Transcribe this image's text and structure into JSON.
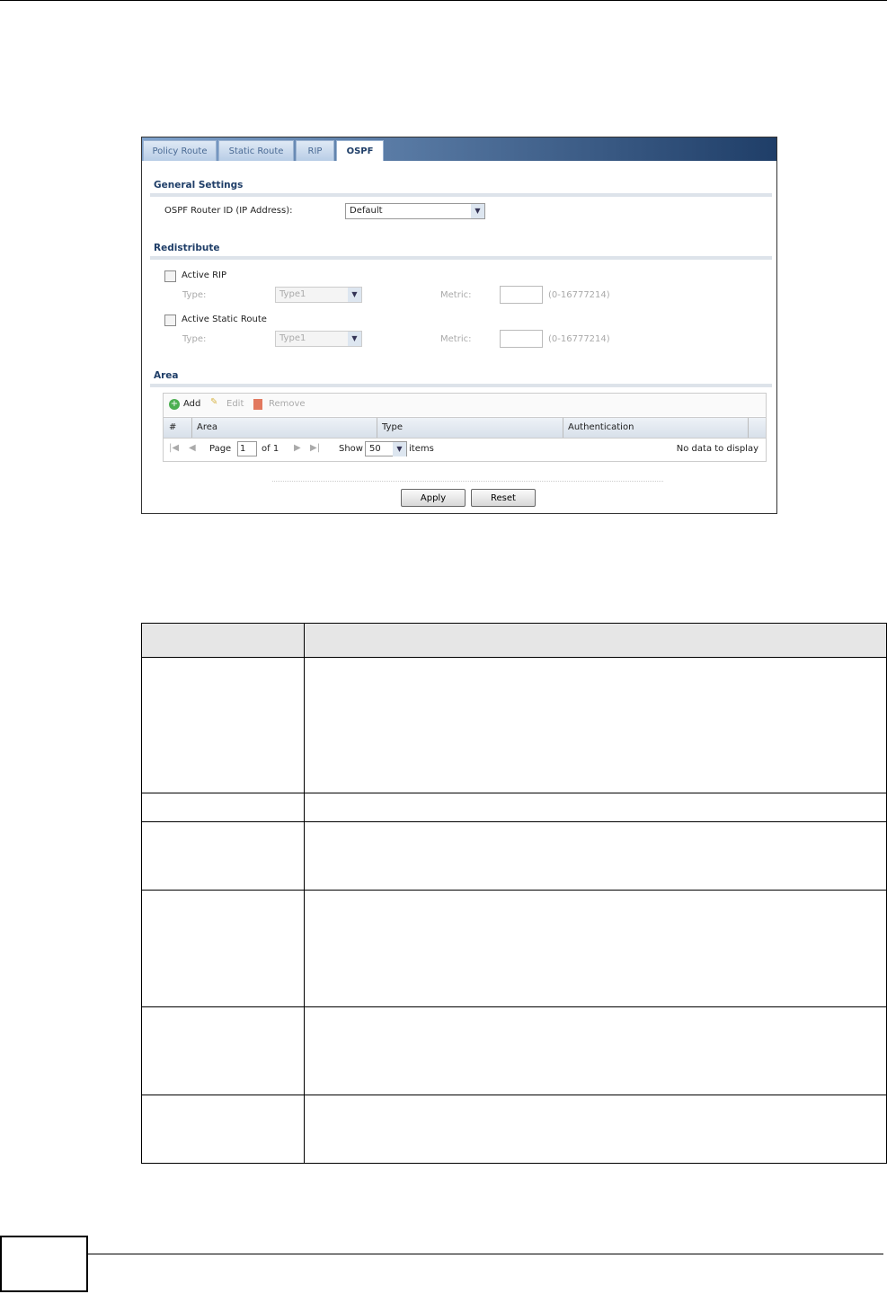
{
  "tabs": [
    "Policy Route",
    "Static Route",
    "RIP",
    "OSPF"
  ],
  "general": {
    "title": "General Settings",
    "router_id_label": "OSPF Router ID (IP Address):",
    "router_id_value": "Default"
  },
  "redistribute": {
    "title": "Redistribute",
    "rows": [
      {
        "label": "Active RIP",
        "type_label": "Type:",
        "type_value": "Type1",
        "metric_label": "Metric:",
        "range": "(0-16777214)"
      },
      {
        "label": "Active Static Route",
        "type_label": "Type:",
        "type_value": "Type1",
        "metric_label": "Metric:",
        "range": "(0-16777214)"
      }
    ]
  },
  "area": {
    "title": "Area",
    "toolbar": {
      "add": "Add",
      "edit": "Edit",
      "remove": "Remove"
    },
    "columns": [
      "#",
      "Area",
      "Type",
      "Authentication"
    ],
    "pager": {
      "page_label": "Page",
      "page": "1",
      "of": "of 1",
      "show": "Show",
      "per_page": "50",
      "items": "items",
      "empty": "No data to display"
    }
  },
  "buttons": {
    "apply": "Apply",
    "reset": "Reset"
  }
}
